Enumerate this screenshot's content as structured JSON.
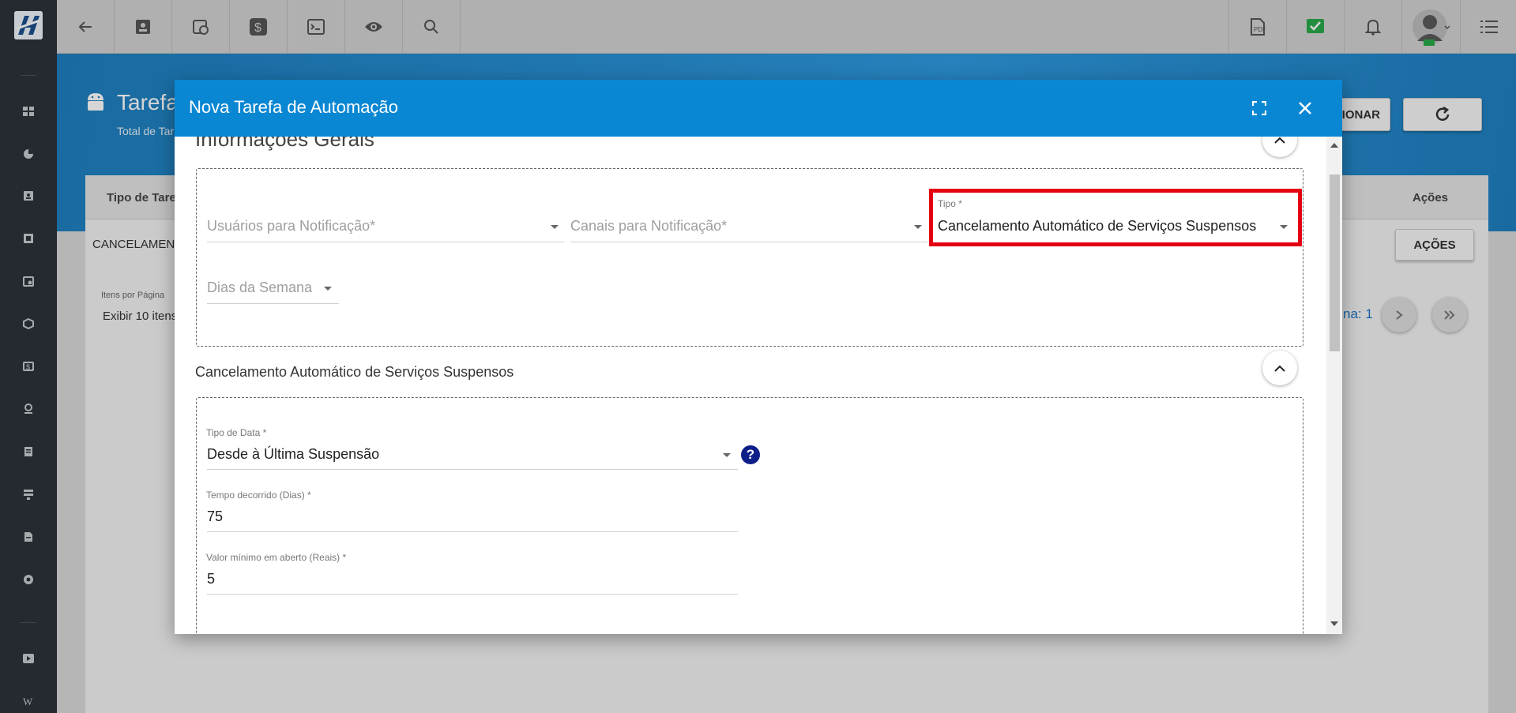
{
  "topbar": {
    "icons": [
      "back-arrow-icon",
      "contact-card-icon",
      "calendar-clock-icon",
      "dollar-icon",
      "terminal-icon",
      "eye-icon",
      "search-icon"
    ],
    "right_icons": [
      "pdf-icon",
      "approved-check-icon",
      "bell-icon",
      "avatar",
      "menu-list-icon"
    ]
  },
  "page": {
    "title": "Tarefa",
    "subtitle": "Total de Tar",
    "add_button_fragment": "CIONAR",
    "table": {
      "col_tipo": "Tipo de Taref",
      "col_acoes": "Ações",
      "row1_tipo": "CANCELAMENT",
      "row1_acoes_button": "AÇÕES"
    },
    "pagination": {
      "items_per_page_label": "Itens por Página",
      "items_per_page_value": "Exibir 10 itens",
      "page_fragment": "na: 1"
    }
  },
  "modal": {
    "title": "Nova Tarefa de Automação",
    "general_section_title": "Informações Gerais",
    "fields": {
      "usuarios_placeholder": "Usuários para Notificação*",
      "canais_placeholder": "Canais para Notificação*",
      "tipo_label": "Tipo *",
      "tipo_value": "Cancelamento Automático de Serviços Suspensos",
      "dias_placeholder": "Dias da Semana"
    },
    "sub_section_title": "Cancelamento Automático de Serviços Suspensos",
    "sub_fields": {
      "tipo_data_label": "Tipo de Data *",
      "tipo_data_value": "Desde à Última Suspensão",
      "tempo_label": "Tempo decorrido (Dias) *",
      "tempo_value": "75",
      "valor_label": "Valor mínimo em aberto (Reais) *",
      "valor_value": "5",
      "help_glyph": "?"
    }
  },
  "colors": {
    "modal_header": "#0a87d3",
    "highlight": "#e40012",
    "sidebar": "#2d333b",
    "help_icon": "#0f1f8a"
  }
}
